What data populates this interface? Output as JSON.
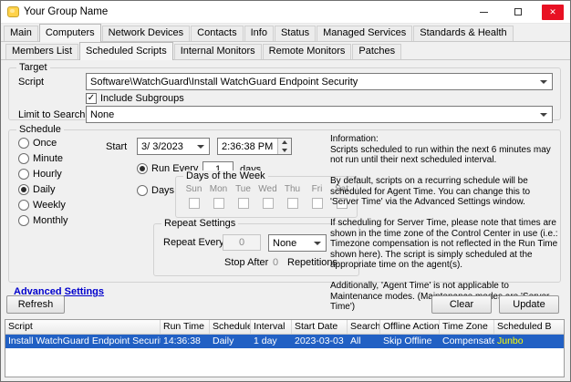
{
  "colors": {
    "selection_blue": "#2160c4",
    "highlight_yellow": "#ffff00",
    "link_blue": "#0000cc",
    "close_red": "#e81123",
    "icon_yellow": "#ffd24a",
    "dialog_bg": "#f0f0f0"
  },
  "icons": {
    "close": "✕",
    "checkmark": "✓",
    "minimize": "minimize-bar-shape",
    "maximize": "square-outline-shape",
    "dropdown": "triangle-down-shape",
    "spin_up": "triangle-up-shape",
    "spin_down": "triangle-down-shape"
  },
  "window": {
    "title": "Your Group Name"
  },
  "tabs_row1": [
    {
      "label": "Main",
      "active": false
    },
    {
      "label": "Computers",
      "active": true
    },
    {
      "label": "Network Devices",
      "active": false
    },
    {
      "label": "Contacts",
      "active": false
    },
    {
      "label": "Info",
      "active": false
    },
    {
      "label": "Status",
      "active": false
    },
    {
      "label": "Managed Services",
      "active": false
    },
    {
      "label": "Standards & Health",
      "active": false
    }
  ],
  "tabs_row2": [
    {
      "label": "Members List",
      "active": false
    },
    {
      "label": "Scheduled Scripts",
      "active": true
    },
    {
      "label": "Internal Monitors",
      "active": false
    },
    {
      "label": "Remote Monitors",
      "active": false
    },
    {
      "label": "Patches",
      "active": false
    }
  ],
  "target": {
    "legend": "Target",
    "script_label": "Script",
    "script_value": "Software\\WatchGuard\\Install WatchGuard Endpoint Security",
    "include_subgroups_label": "Include Subgroups",
    "include_subgroups_checked": true,
    "limit_label": "Limit to Search",
    "limit_value": "None"
  },
  "schedule": {
    "legend": "Schedule",
    "frequency_options": [
      "Once",
      "Minute",
      "Hourly",
      "Daily",
      "Weekly",
      "Monthly"
    ],
    "selected_frequency": "Daily",
    "start_label": "Start",
    "start_date": "3/ 3/2023",
    "start_time": "2:36:38 PM",
    "run_every_label": "Run Every",
    "run_every_value": "1",
    "run_every_unit": "days",
    "days_label": "Days",
    "dow_legend": "Days of the Week",
    "days_of_week": [
      "Sun",
      "Mon",
      "Tue",
      "Wed",
      "Thu",
      "Fri",
      "Sat"
    ],
    "repeat_legend": "Repeat Settings",
    "repeat_every_label": "Repeat Every",
    "repeat_every_value": "0",
    "repeat_interval_value": "None",
    "stop_after_label": "Stop After",
    "stop_after_value": "0",
    "repetitions_label": "Repetitions",
    "info": "Information:\nScripts scheduled to run within the next 6 minutes may not run until their next scheduled interval.\n\nBy default, scripts on a recurring schedule will be scheduled for Agent Time. You can change this to 'Server Time' via the Advanced Settings window.\n\nIf scheduling for Server Time, please note that times are shown in the time zone of the Control Center in use (i.e.: Timezone compensation is not reflected in the Run Time shown here). The script is simply scheduled at the appropriate time on the agent(s).\n\nAdditionally, 'Agent Time' is not applicable to Maintenance modes. (Maintenance modes are 'Server Time')"
  },
  "advanced_settings_label": "Advanced Settings",
  "buttons": {
    "refresh": "Refresh",
    "clear": "Clear",
    "update": "Update"
  },
  "table": {
    "columns": [
      "Script",
      "Run Time",
      "Schedule",
      "Interval",
      "Start Date",
      "Search",
      "Offline Action",
      "Time Zone",
      "Scheduled B"
    ],
    "rows": [
      [
        "Install WatchGuard Endpoint Security",
        "14:36:38",
        "Daily",
        "1 day",
        "2023-03-03",
        "All",
        "Skip Offline",
        "Compensated",
        "Junbo"
      ]
    ]
  }
}
